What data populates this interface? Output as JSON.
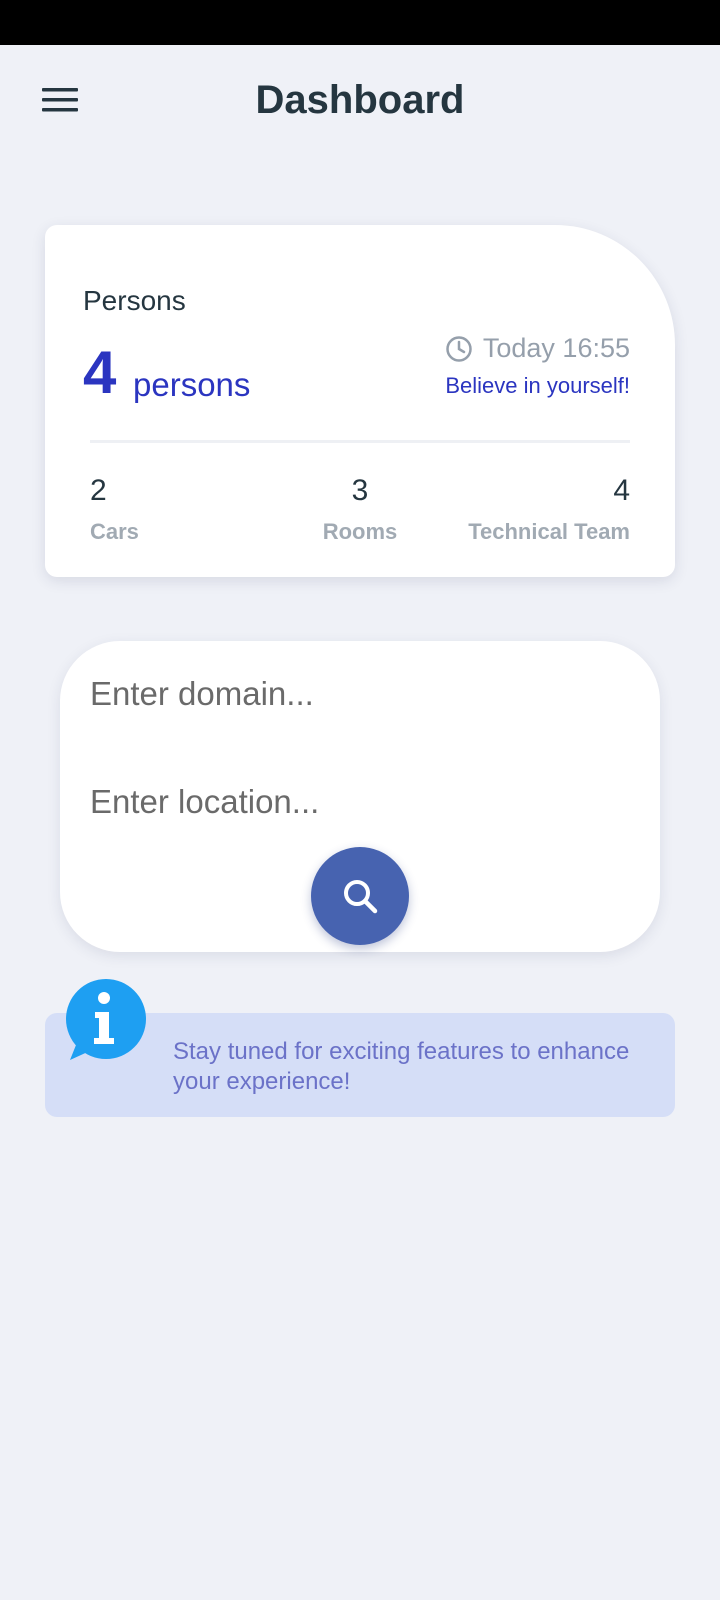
{
  "header": {
    "title": "Dashboard",
    "menu_icon": "hamburger-menu-icon"
  },
  "persons_card": {
    "label": "Persons",
    "count": "4",
    "unit": "persons",
    "time": "Today 16:55",
    "time_icon": "clock-icon",
    "motto": "Believe in yourself!",
    "stats": [
      {
        "value": "2",
        "label": "Cars"
      },
      {
        "value": "3",
        "label": "Rooms"
      },
      {
        "value": "4",
        "label": "Technical Team"
      }
    ]
  },
  "search": {
    "domain_placeholder": "Enter domain...",
    "location_placeholder": "Enter location...",
    "button_icon": "search-icon"
  },
  "info": {
    "icon": "info-icon",
    "text": "Stay tuned for exciting features to enhance your experience!"
  },
  "colors": {
    "background": "#eff1f7",
    "accent": "#2b35c0",
    "search_button": "#4763b0",
    "info_background": "#d5def7",
    "info_text": "#6b72c8",
    "info_icon": "#1e9ff2"
  }
}
